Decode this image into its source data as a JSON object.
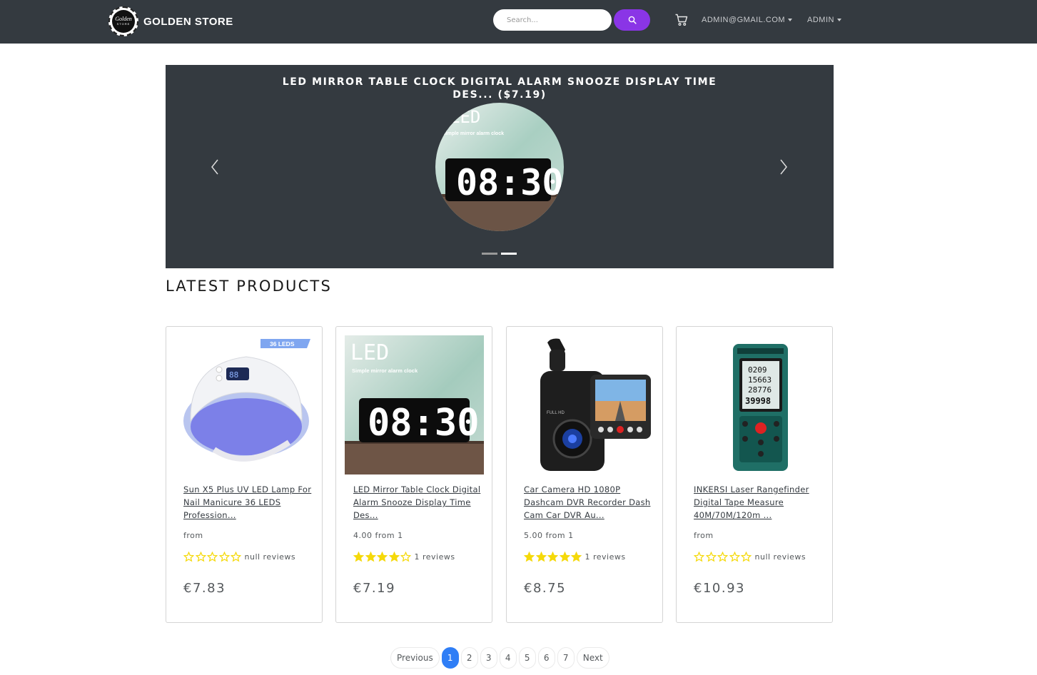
{
  "navbar": {
    "brand": "GOLDEN STORE",
    "logo_line1": "Golden",
    "logo_line2": "STORE",
    "search_placeholder": "Search...",
    "user_menu": "ADMIN@GMAIL.COM",
    "admin_menu": "ADMIN",
    "accent_color": "#8a35e6"
  },
  "carousel": {
    "title": "LED MIRROR TABLE CLOCK DIGITAL ALARM SNOOZE DISPLAY TIME DES... ($7.19)",
    "image_text_led": "LED",
    "image_text_sub": "Simple mirror alarm clock",
    "image_text_clock": "08:30",
    "active_index": 1
  },
  "section_title": "LATEST PRODUCTS",
  "products": [
    {
      "title": "Sun X5 Plus UV LED Lamp For Nail Manicure 36 LEDS Profession...",
      "rating_text": "from",
      "rating": 0,
      "reviews": "null reviews",
      "price": "€7.83",
      "badge": "36 LEDS",
      "image": "nail-lamp-image"
    },
    {
      "title": "LED Mirror Table Clock Digital Alarm Snooze Display Time Des...",
      "rating_text": "4.00 from 1",
      "rating": 4,
      "reviews": "1 reviews",
      "price": "€7.19",
      "image": "led-clock-image"
    },
    {
      "title": "Car Camera HD 1080P Dashcam DVR Recorder Dash Cam Car DVR Au...",
      "rating_text": "5.00 from 1",
      "rating": 5,
      "reviews": "1 reviews",
      "price": "€8.75",
      "image": "dashcam-image"
    },
    {
      "title": "INKERSI Laser Rangefinder Digital Tape Measure 40M/70M/120m ...",
      "rating_text": "from",
      "rating": 0,
      "reviews": "null reviews",
      "price": "€10.93",
      "image": "rangefinder-image"
    }
  ],
  "pagination": {
    "previous": "Previous",
    "next": "Next",
    "pages": [
      "1",
      "2",
      "3",
      "4",
      "5",
      "6",
      "7"
    ],
    "active": "1",
    "active_color": "#2f7ef6"
  },
  "star_color": "#f5d90a"
}
